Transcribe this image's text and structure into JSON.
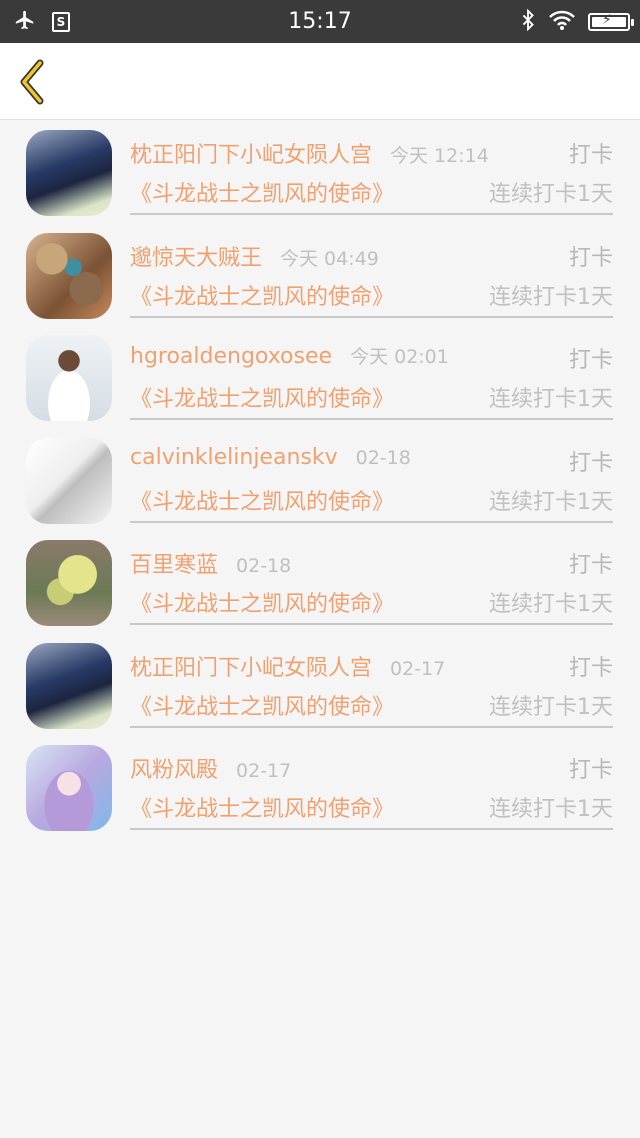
{
  "status_bar": {
    "time": "15:17",
    "left_icons": [
      "airplane-icon",
      "s-app-icon"
    ],
    "right_icons": [
      "bluetooth-icon",
      "wifi-icon",
      "battery-charging-icon"
    ]
  },
  "nav": {
    "back_icon": "chevron-left-icon",
    "accent_color": "#f0a170"
  },
  "checkins": [
    {
      "name": "枕正阳门下小屺女陨人宫",
      "time": "今天 12:14",
      "action": "打卡",
      "title": "《斗龙战士之凯风的使命》",
      "streak": "连续打卡1天"
    },
    {
      "name": "邈惊天大贼王",
      "time": "今天 04:49",
      "action": "打卡",
      "title": "《斗龙战士之凯风的使命》",
      "streak": "连续打卡1天"
    },
    {
      "name": "hgroaldengoxosee",
      "time": "今天 02:01",
      "action": "打卡",
      "title": "《斗龙战士之凯风的使命》",
      "streak": "连续打卡1天"
    },
    {
      "name": "calvinklelinjeanskv",
      "time": "02-18",
      "action": "打卡",
      "title": "《斗龙战士之凯风的使命》",
      "streak": "连续打卡1天"
    },
    {
      "name": "百里寒蓝",
      "time": "02-18",
      "action": "打卡",
      "title": "《斗龙战士之凯风的使命》",
      "streak": "连续打卡1天"
    },
    {
      "name": "枕正阳门下小屺女陨人宫",
      "time": "02-17",
      "action": "打卡",
      "title": "《斗龙战士之凯风的使命》",
      "streak": "连续打卡1天"
    },
    {
      "name": "风粉风殿",
      "time": "02-17",
      "action": "打卡",
      "title": "《斗龙战士之凯风的使命》",
      "streak": "连续打卡1天"
    }
  ]
}
